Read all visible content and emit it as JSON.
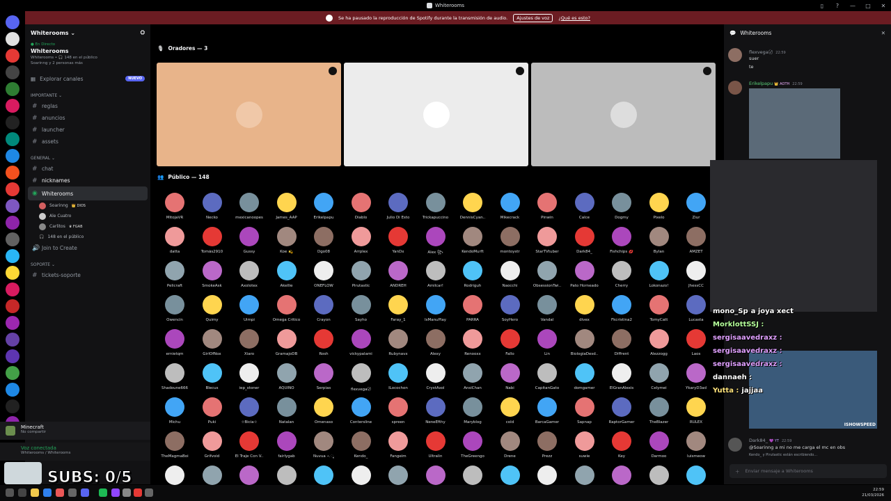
{
  "window": {
    "title": "Whiterooms",
    "controls": [
      "▯",
      "?",
      "—",
      "□",
      "✕"
    ]
  },
  "notice": {
    "text": "Se ha pausado la reproducción de Spotify durante la transmisión de audio.",
    "button": "Ajustes de voz",
    "link": "¿Qué es esto?"
  },
  "sidebar": {
    "server_name": "Whiterooms ⌄",
    "live_tag": "● En Directo",
    "live_title": "Whiterooms",
    "live_sub": "Whiterooms • 🎧 148 en el público",
    "live_sub2": "Soarinng y 2 personas más",
    "explore": "Explorar canales",
    "new_badge": "NUEVO",
    "cat_important": "IMPORTANTE ⌄",
    "ch_reglas": "reglas",
    "ch_anuncios": "anuncios",
    "ch_launcher": "launcher",
    "ch_assets": "assets",
    "cat_general": "GENERAL ⌄",
    "ch_chat": "chat",
    "ch_nicknames": "nicknames",
    "ch_stage": "Whiterooms",
    "ch_stage_sub": "Whiterooms",
    "voice_users": [
      {
        "name": "Soarinng",
        "tag": "👑 DIOS",
        "color": "#d35f5f"
      },
      {
        "name": "Ale Cuatro",
        "tag": "",
        "color": "#cccccc"
      },
      {
        "name": "Carlitos",
        "tag": "♛ FGAB",
        "color": "#888888"
      }
    ],
    "audience_count": "148 en el público",
    "join_create": "Join to Create",
    "cat_soporte": "SOPORTE ⌄",
    "ch_tickets": "tickets-soporte",
    "minecraft_title": "Minecraft",
    "minecraft_sub": "No compartir",
    "voice_connected": "Voz conectada",
    "voice_location": "Whiterooms / Whiterooms",
    "subs_counter": "SUBS: 0/5"
  },
  "stage": {
    "speakers_header": "Oradores — 3",
    "audience_header": "Público — 148",
    "speaker_tiles": [
      {
        "bg": "#e8b48a",
        "avatar": "#f0c8a8"
      },
      {
        "bg": "#ececec",
        "avatar": "#ffffff"
      },
      {
        "bg": "#bcbcbc",
        "avatar": "#dddddd"
      }
    ],
    "audience": [
      [
        "MitojaVR",
        "Necko",
        "mexicanoopes",
        "James_AAP",
        "Erikelpapu",
        "Diablo",
        "Julio Di Esto",
        "Trickapuccino",
        "DennisCyan..",
        "Mikecrack",
        "Pinwin",
        "Calce",
        "Dogmy",
        "Pixelo",
        "Ziur"
      ],
      [
        "datta",
        "Tomás2910",
        "Gussy",
        "Koe 💫",
        "Dgo08",
        "Arrplex",
        "YanDx",
        "Alex ꧂",
        "KendoMurft",
        "montoystr",
        "StarTVtuber",
        "Dark84_",
        "Fishchips 💋",
        "Bylan",
        "AMZET"
      ],
      [
        "Pelicraft",
        "SmokeAsk",
        "Axolotex",
        "Akellie",
        "ONEFLOW",
        "Pirutastic",
        "ANDREH",
        "Amilcar!",
        "Rodriguh",
        "Naocchi",
        "ObsessionTwi..",
        "Pato Horneado",
        "Cherry",
        "Lokonazo!",
        "JhessCC"
      ],
      [
        "Owencin",
        "Quimy",
        "Uimpi",
        "Omega Critico",
        "Crayon",
        "Sayho",
        "Faray_1",
        "IsManuPlay",
        "PARRA",
        "SoyHero",
        "Vandal",
        "divex",
        "Fkcristina2",
        "TomyCatt",
        "Lucasta"
      ],
      [
        "ernietqm",
        "GirlOfNox",
        "Xiaro",
        "GramajoDB",
        "Rosh",
        "vickypalami",
        "Rubynavx",
        "Alexy",
        "Renooxx",
        "Fallo",
        "Lin",
        "BiologiaDesd..",
        "Diffrent",
        "Alezzogg",
        "Laos"
      ],
      [
        "Shadoune666",
        "Blecus",
        "iep_stoner",
        "AQUINO",
        "Serpias",
        "flexvega〄",
        "ILocochon",
        "CrystAxol",
        "AnsiChan",
        "Nabi",
        "CapitanGato",
        "domgamer",
        "ElGranAlexis",
        "Celymei",
        "YkaryD3ad"
      ],
      [
        "Michu",
        "Puki",
        "☆Bicia☆",
        "Natalan",
        "Omenaso",
        "Contersline",
        "spreen",
        "NeneEfthy",
        "Maryblog",
        "cold",
        "BarcaGamer",
        "Sapnap",
        "RaptorGamer",
        "TheBlazer",
        "RULEX"
      ],
      [
        "TheMagmaBoi",
        "Grifvoid",
        "El Traje Con V..",
        "fairlygab",
        "Nuvua ⋆.ೃ",
        "Kendo_",
        "Fangeim",
        "Ultralin",
        "TheGreengo",
        "Drene",
        "Prezz",
        "suwie",
        "Key",
        "Darmoo",
        "luismeow"
      ],
      [
        "",
        "",
        "",
        "",
        "",
        "",
        "",
        "",
        "",
        "",
        "",
        "",
        "",
        "",
        ""
      ]
    ]
  },
  "chat": {
    "title": "Whiterooms",
    "messages": [
      {
        "author": "flexvega〄",
        "time": "22:59",
        "lines": [
          "suer",
          "te"
        ]
      },
      {
        "author": "Erikelpapu",
        "badge": "👑 AOTH",
        "time": "22:59"
      },
      {
        "author": "Dark84_",
        "badge": "💜 YT",
        "time": "22:59",
        "lines": [
          "@Soarinng a mi no me carga el mc en obs"
        ]
      }
    ],
    "typing": "Kendo_ y Pirutastic están escribiendo...",
    "overlay_lines": [
      {
        "name": "mono_Sp",
        "text": "a joya xect",
        "color": "#ffffff"
      },
      {
        "name": "MorklottSSJ :",
        "text": "",
        "color": "#b5ff9a"
      },
      {
        "name": "sergisaavedraxz :",
        "text": "",
        "color": "#e0a0ff"
      },
      {
        "name": "sergisaavedraxz :",
        "text": "",
        "color": "#e0a0ff"
      },
      {
        "name": "sergisaavedraxz :",
        "text": "",
        "color": "#e0a0ff"
      },
      {
        "name": "dannaeh :",
        "text": "",
        "color": "#ffffff"
      },
      {
        "name": "Yutta :",
        "text": "jajjaa",
        "color": "#ffe27a"
      }
    ],
    "clip_label": "ISHOWSPEED",
    "input_placeholder": "Enviar mensaje a Whiterooms"
  },
  "taskbar": {
    "time": "22:59",
    "date": "21/03/2026"
  }
}
